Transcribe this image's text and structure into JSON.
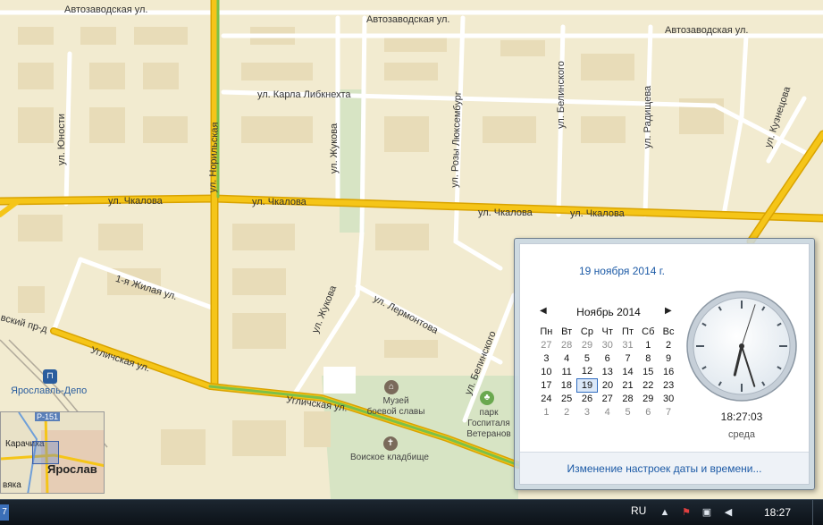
{
  "map": {
    "streets": {
      "avtozavodskaya_1": "Автозаводская ул.",
      "avtozavodskaya_2": "Автозаводская ул.",
      "avtozavodskaya_3": "Автозаводская ул.",
      "karla_libknekhta": "ул. Карла Либкнехта",
      "chkalova_1": "ул. Чкалова",
      "chkalova_2": "ул. Чкалова",
      "chkalova_3": "ул. Чкалова",
      "chkalova_4": "ул. Чкалова",
      "yunosti": "ул. Юности",
      "norilskaya": "ул. Норильская",
      "zhukova_1": "ул. Жукова",
      "zhukova_2": "ул. Жукова",
      "rozy_lyuksemburg": "ул. Розы Люксембург",
      "belinskogo_1": "ул. Белинского",
      "belinskogo_2": "ул. Белинского",
      "radishcheva": "ул. Радищева",
      "kuznetsova": "ул. Кузнецова",
      "zhilaya_1": "1-я Жилая ул.",
      "lermontova": "ул. Лермонтова",
      "prospekt": "вский пр-д",
      "ulichskaya_1": "Угличская ул.",
      "ulichskaya_2": "Угличская ул."
    },
    "pois": {
      "museum": "Музей\nбоевой славы",
      "park": "парк\nГоспиталя\nВетеранов",
      "cemetery": "Воиское кладбище",
      "station": "Ярославль-Депо"
    },
    "minimap": {
      "road_badge": "Р-151",
      "town": "Карачиха",
      "city": "Ярослав",
      "lower": "вяка"
    }
  },
  "calendar_popup": {
    "date_header": "19 ноября 2014 г.",
    "prev_month": "◀",
    "next_month": "▶",
    "month_title": "Ноябрь 2014",
    "weekdays": [
      "Пн",
      "Вт",
      "Ср",
      "Чт",
      "Пт",
      "Сб",
      "Вс"
    ],
    "weeks": [
      [
        "27",
        "28",
        "29",
        "30",
        "31",
        "1",
        "2"
      ],
      [
        "3",
        "4",
        "5",
        "6",
        "7",
        "8",
        "9"
      ],
      [
        "10",
        "11",
        "12",
        "13",
        "14",
        "15",
        "16"
      ],
      [
        "17",
        "18",
        "19",
        "20",
        "21",
        "22",
        "23"
      ],
      [
        "24",
        "25",
        "26",
        "27",
        "28",
        "29",
        "30"
      ],
      [
        "1",
        "2",
        "3",
        "4",
        "5",
        "6",
        "7"
      ]
    ],
    "today": "19",
    "digital_time": "18:27:03",
    "weekday_name": "среда",
    "settings_link": "Изменение настроек даты и времени..."
  },
  "taskbar": {
    "start_stub": "7",
    "language": "RU",
    "clock": "18:27"
  },
  "colors": {
    "map_background": "#f2ebd0",
    "major_road": "#f5c518",
    "traffic_green": "#7cc04a",
    "link_blue": "#1c5aa6"
  }
}
